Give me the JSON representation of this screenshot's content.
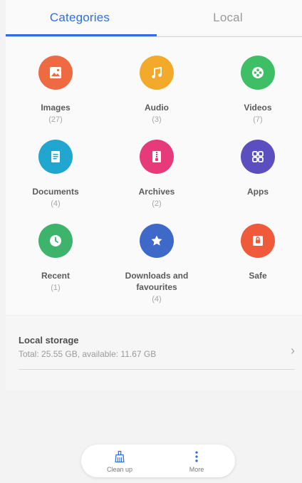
{
  "tabs": {
    "categories": "Categories",
    "local": "Local"
  },
  "categories": [
    {
      "name": "Images",
      "count": "(27)",
      "color": "#ee6a42",
      "icon": "image-icon"
    },
    {
      "name": "Audio",
      "count": "(3)",
      "color": "#f3aa2b",
      "icon": "music-note-icon"
    },
    {
      "name": "Videos",
      "count": "(7)",
      "color": "#3fbf65",
      "icon": "film-reel-icon"
    },
    {
      "name": "Documents",
      "count": "(4)",
      "color": "#20a6cf",
      "icon": "document-icon"
    },
    {
      "name": "Archives",
      "count": "(2)",
      "color": "#e63a7a",
      "icon": "archive-icon"
    },
    {
      "name": "Apps",
      "count": "",
      "color": "#5b4fc0",
      "icon": "apps-grid-icon"
    },
    {
      "name": "Recent",
      "count": "(1)",
      "color": "#3db36c",
      "icon": "clock-icon"
    },
    {
      "name": "Downloads and favourites",
      "count": "(4)",
      "color": "#3e69c9",
      "icon": "star-icon"
    },
    {
      "name": "Safe",
      "count": "",
      "color": "#ee5a3a",
      "icon": "safe-icon"
    }
  ],
  "storage": {
    "title": "Local storage",
    "subtitle": "Total: 25.55 GB, available: 11.67 GB"
  },
  "bottom_bar": {
    "cleanup_label": "Clean up",
    "more_label": "More"
  },
  "colors": {
    "accent": "#2f6ee6"
  }
}
